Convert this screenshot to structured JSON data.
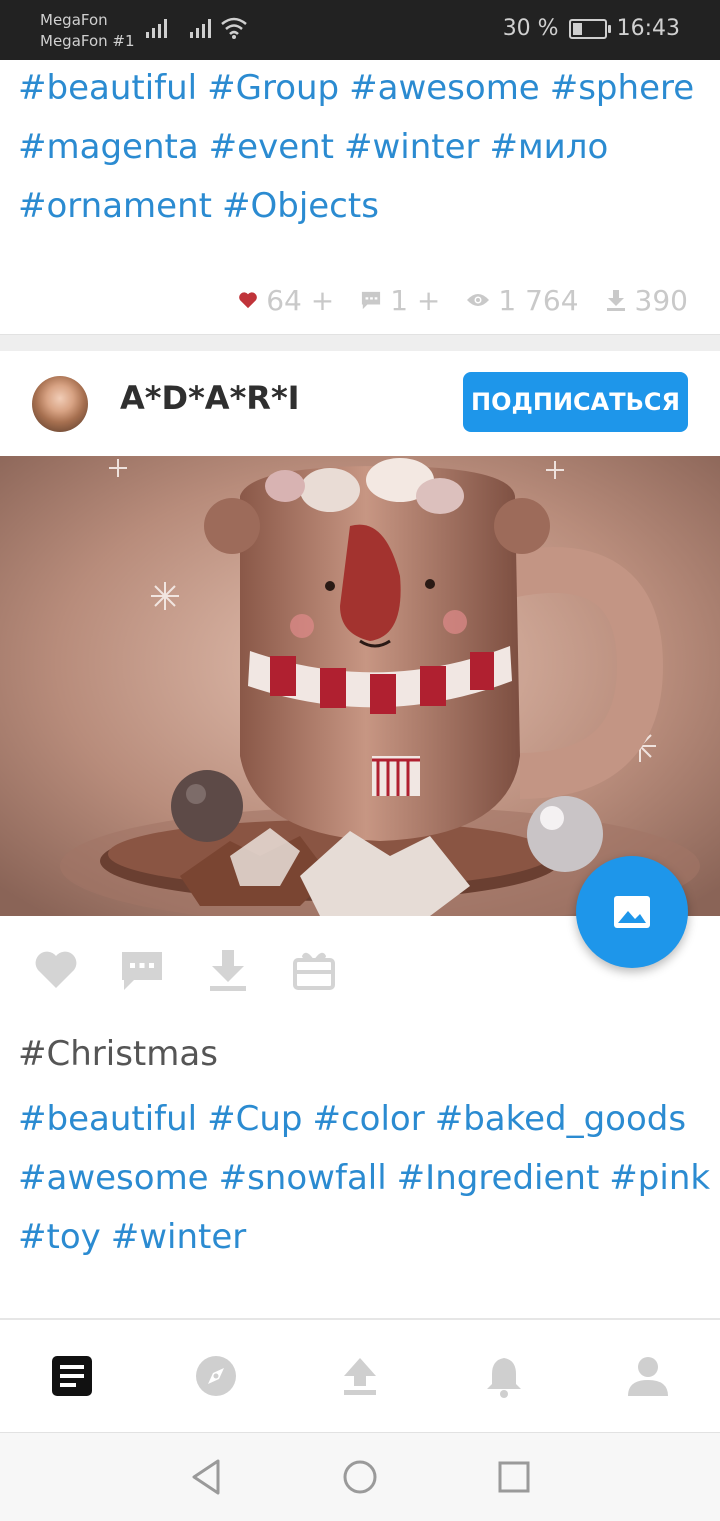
{
  "status_bar": {
    "carrier1": "MegaFon",
    "carrier2": "MegaFon #1",
    "battery_text": "30 %",
    "battery_level": 0.3,
    "time": "16:43"
  },
  "post1": {
    "tags": [
      "#beautiful",
      "#Group",
      "#awesome",
      "#sphere",
      "#magenta",
      "#event",
      "#winter",
      "#мило",
      "#ornament",
      "#Objects"
    ],
    "likes": "64 +",
    "comments": "1 +",
    "views": "1 764",
    "downloads": "390"
  },
  "post2": {
    "username": "A*D*A*R*I",
    "subscribe_label": "ПОДПИСАТЬСЯ",
    "caption": "#Christmas",
    "tags": [
      "#beautiful",
      "#Cup",
      "#color",
      "#baked_goods",
      "#awesome",
      "#snowfall",
      "#Ingredient",
      "#pink",
      "#toy",
      "#winter"
    ]
  },
  "icons": {
    "like": "heart-icon",
    "comment": "comment-icon",
    "download": "download-icon",
    "gift": "gift-icon",
    "fab": "image-icon",
    "nav": [
      "feed-icon",
      "explore-icon",
      "upload-icon",
      "notifications-icon",
      "profile-icon"
    ]
  },
  "colors": {
    "accent": "#1e96ea",
    "tag": "#2b8bd1",
    "heart": "#c0343a",
    "muted": "#c9c9c9"
  }
}
